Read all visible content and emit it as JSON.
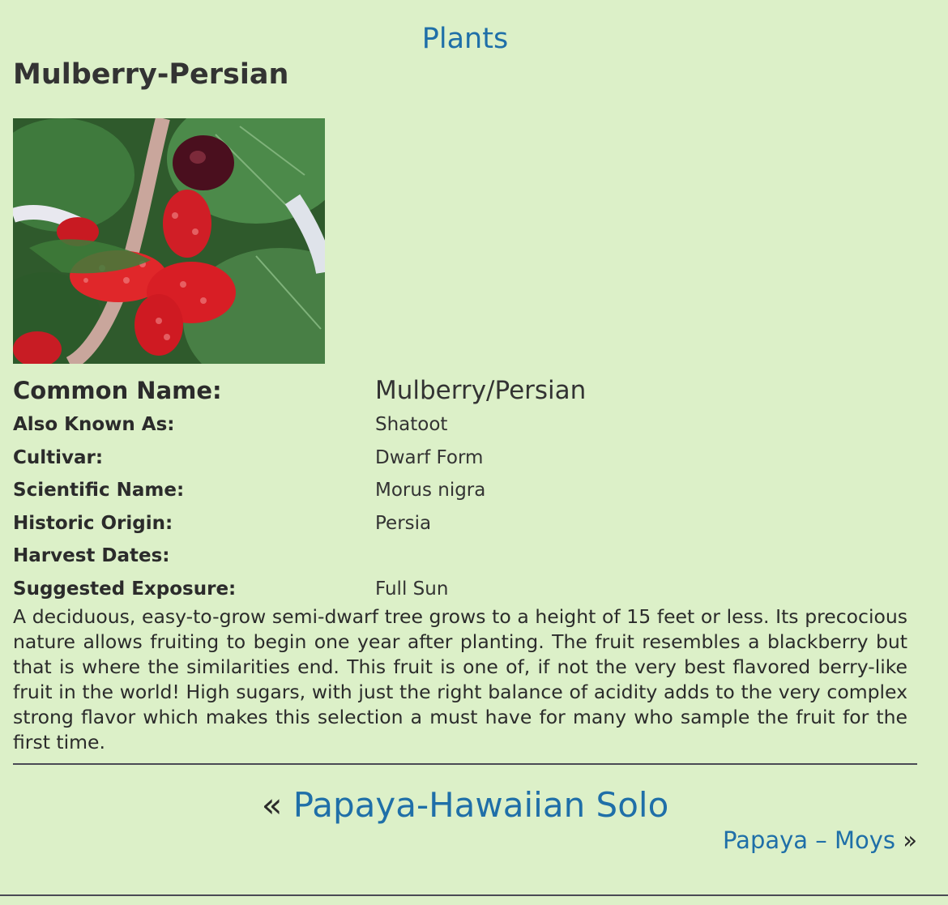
{
  "breadcrumb": {
    "label": "Plants"
  },
  "plant": {
    "title": "Mulberry-Persian",
    "image_alt": "Mulberry-Persian",
    "details": [
      {
        "label": "Common Name:",
        "value": "Mulberry/Persian"
      },
      {
        "label": "Also Known As:",
        "value": "Shatoot"
      },
      {
        "label": "Cultivar:",
        "value": "Dwarf Form"
      },
      {
        "label": "Scientific Name:",
        "value": "Morus nigra"
      },
      {
        "label": "Historic Origin:",
        "value": "Persia"
      },
      {
        "label": "Harvest Dates:",
        "value": ""
      },
      {
        "label": "Suggested Exposure:",
        "value": "Full Sun"
      }
    ],
    "description": "A deciduous, easy-to-grow semi-dwarf tree grows to a height of 15 feet or less. Its precocious nature allows fruiting to begin one year after planting. The fruit resembles a blackberry but that is where the similarities end. This fruit is one of, if not the very best flavored berry-like fruit in the world! High sugars, with just the right balance of acidity adds to the very complex strong flavor which makes this selection a must have for many who sample the fruit for the first time."
  },
  "navigation": {
    "prev_arrow": "«",
    "prev_label": "Papaya-Hawaiian Solo",
    "next_label": "Papaya – Moys",
    "next_arrow": "»"
  },
  "colors": {
    "background": "#dcf0c8",
    "link": "#1f6fa8",
    "text": "#2b2b2b"
  }
}
